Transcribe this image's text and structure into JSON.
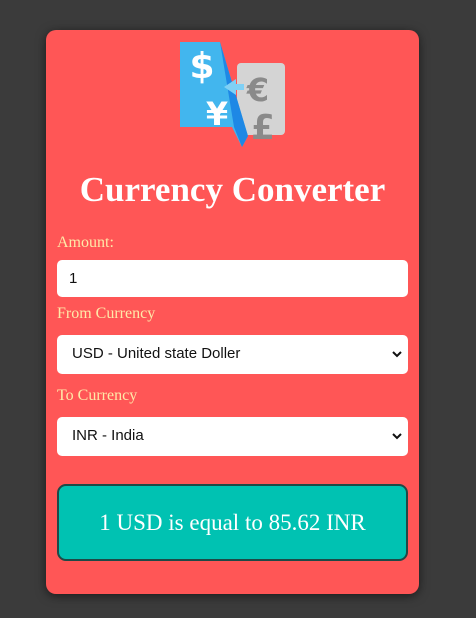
{
  "app": {
    "title": "Currency Converter",
    "logo_icon": "currency-exchange-icon"
  },
  "form": {
    "amount_label": "Amount:",
    "amount_value": "1",
    "from_label": "From Currency",
    "from_selected": "USD - United state Doller",
    "to_label": "To Currency",
    "to_selected": "INR - India"
  },
  "result": {
    "text": "1 USD is equal to 85.62 INR"
  },
  "colors": {
    "page_background": "#3b3b3b",
    "card_background": "#ff5656",
    "label_color": "#ffe9a8",
    "result_background": "#00c2b2"
  }
}
